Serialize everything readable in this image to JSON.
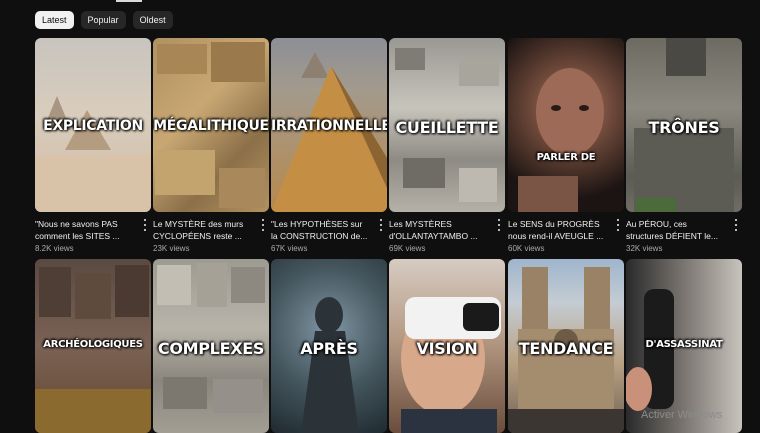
{
  "filters": [
    {
      "label": "Latest",
      "active": true
    },
    {
      "label": "Popular",
      "active": false
    },
    {
      "label": "Oldest",
      "active": false
    }
  ],
  "videos": [
    {
      "overlay": "EXPLICATION",
      "title": "\"Nous ne savons PAS comment les SITES ...",
      "views": "8.2K views"
    },
    {
      "overlay": "MÉGALITHIQUE",
      "title": "Le MYSTÈRE des murs CYCLOPÉENS reste ...",
      "views": "23K views"
    },
    {
      "overlay": "IRRATIONNELLES",
      "title": "\"Les HYPOTHÈSES sur la CONSTRUCTION de...",
      "views": "67K views"
    },
    {
      "overlay": "CUEILLETTE",
      "title": "Les MYSTÈRES d'OLLANTAYTAMBO ...",
      "views": "69K views"
    },
    {
      "overlay": "PARLER DE",
      "title": "Le SENS du PROGRÈS nous rend-il AVEUGLE ...",
      "views": "60K views"
    },
    {
      "overlay": "TRÔNES",
      "title": "Au PÉROU, ces structures DÉFIENT le...",
      "views": "32K views"
    },
    {
      "overlay": "ARCHÉOLOGIQUES"
    },
    {
      "overlay": "COMPLEXES"
    },
    {
      "overlay": "APRÈS"
    },
    {
      "overlay": "VISION"
    },
    {
      "overlay": "TENDANCE"
    },
    {
      "overlay": "D'ASSASSINAT"
    }
  ],
  "watermark": "Activer Windows"
}
